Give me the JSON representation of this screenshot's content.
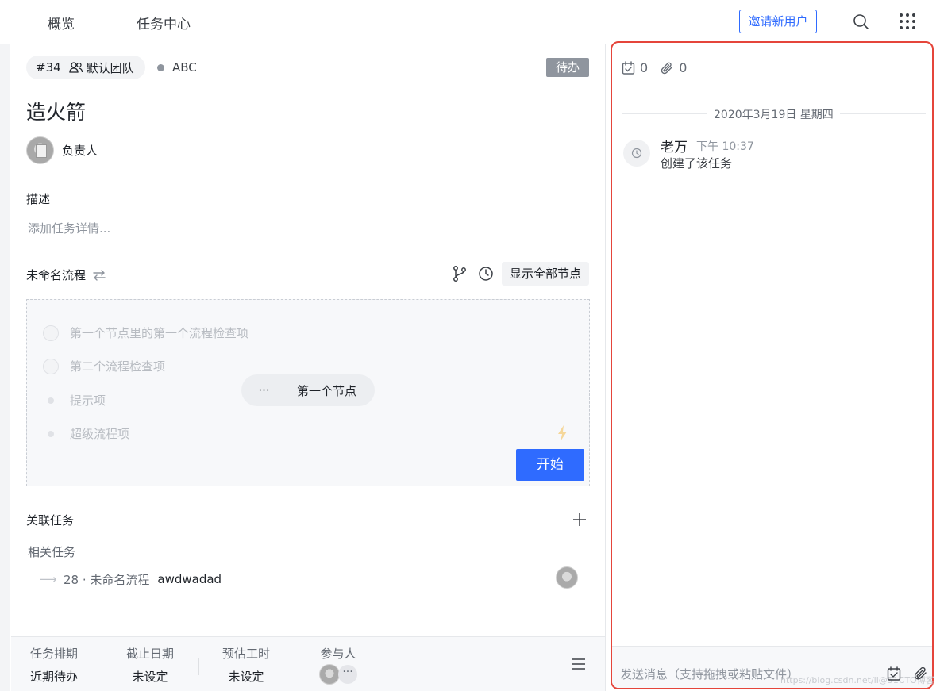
{
  "topnav": {
    "tabs": [
      "概览",
      "任务中心"
    ],
    "invite_label": "邀请新用户"
  },
  "task": {
    "number": "#34",
    "team": "默认团队",
    "project": "ABC",
    "status": "待办",
    "title": "造火箭",
    "owner_label": "负责人",
    "desc_label": "描述",
    "desc_placeholder": "添加任务详情..."
  },
  "flow": {
    "name": "未命名流程",
    "show_all_label": "显示全部节点",
    "items": [
      {
        "label": "第一个节点里的第一个流程检查项",
        "kind": "check"
      },
      {
        "label": "第二个流程检查项",
        "kind": "check"
      },
      {
        "label": "提示项",
        "kind": "bullet"
      },
      {
        "label": "超级流程项",
        "kind": "bullet"
      }
    ],
    "node_more": "···",
    "node_label": "第一个节点",
    "start_label": "开始"
  },
  "related": {
    "title": "关联任务",
    "subtitle": "相关任务",
    "row": {
      "arrow": "⟶",
      "code": "28 · 未命名流程",
      "name": "awdwadad"
    }
  },
  "footer": {
    "cols": [
      {
        "label": "任务排期",
        "value": "近期待办"
      },
      {
        "label": "截止日期",
        "value": "未设定"
      },
      {
        "label": "预估工时",
        "value": "未设定"
      },
      {
        "label": "参与人",
        "value": ""
      }
    ],
    "more": "···"
  },
  "activity": {
    "checklist_count": "0",
    "attachment_count": "0",
    "date": "2020年3月19日 星期四",
    "user": "老万",
    "time": "下午 10:37",
    "text": "创建了该任务",
    "input_placeholder": "发送消息（支持拖拽或粘贴文件）",
    "watermark": "https://blog.csdn.net/li@51CTO博客"
  },
  "colors": {
    "accent": "#2f6bff",
    "highlight_border": "#e5453b",
    "status_badge": "#8f959e"
  }
}
